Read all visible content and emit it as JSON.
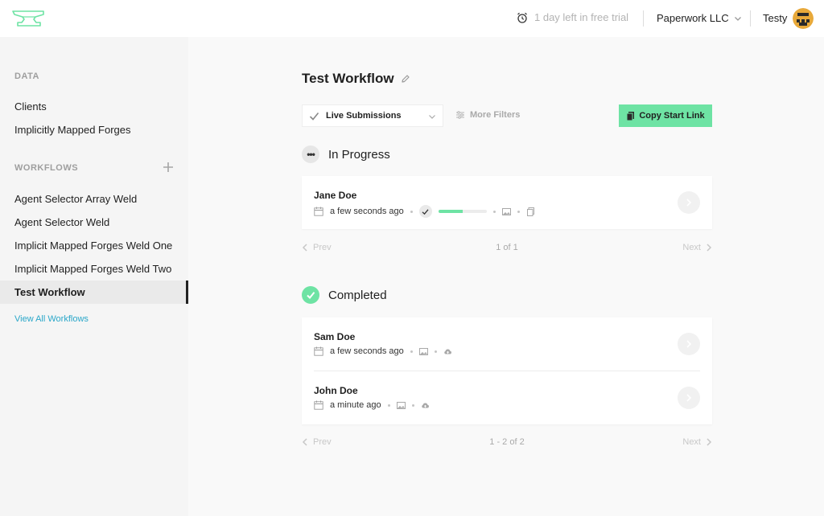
{
  "header": {
    "trial_text": "1 day left in free trial",
    "org_name": "Paperwork LLC",
    "user_name": "Testy"
  },
  "sidebar": {
    "data_label": "DATA",
    "data_items": [
      {
        "label": "Clients"
      },
      {
        "label": "Implicitly Mapped Forges"
      }
    ],
    "workflows_label": "WORKFLOWS",
    "workflow_items": [
      {
        "label": "Agent Selector Array Weld"
      },
      {
        "label": "Agent Selector Weld"
      },
      {
        "label": "Implicit Mapped Forges Weld One"
      },
      {
        "label": "Implicit Mapped Forges Weld Two"
      },
      {
        "label": "Test Workflow",
        "active": true
      }
    ],
    "view_all": "View All Workflows"
  },
  "main": {
    "title": "Test Workflow",
    "filter_value": "Live Submissions",
    "more_filters": "More Filters",
    "copy_link": "Copy Start Link",
    "in_progress": {
      "heading": "In Progress",
      "rows": [
        {
          "name": "Jane Doe",
          "time": "a few seconds ago",
          "progress": 0.5
        }
      ],
      "pager": {
        "prev": "Prev",
        "count": "1 of 1",
        "next": "Next"
      }
    },
    "completed": {
      "heading": "Completed",
      "rows": [
        {
          "name": "Sam Doe",
          "time": "a few seconds ago"
        },
        {
          "name": "John Doe",
          "time": "a minute ago"
        }
      ],
      "pager": {
        "prev": "Prev",
        "count": "1 - 2 of 2",
        "next": "Next"
      }
    }
  },
  "colors": {
    "accent": "#6ee3a4",
    "link": "#2aa7c9"
  },
  "icons": [
    "anvil-logo-icon",
    "alarm-clock-icon",
    "chevron-down-icon",
    "pencil-icon",
    "checkmark-icon",
    "sliders-icon",
    "clipboard-icon",
    "calendar-icon",
    "image-icon",
    "cloud-upload-icon",
    "chevron-right-icon",
    "chevron-left-icon",
    "plus-icon",
    "ellipsis-icon"
  ]
}
